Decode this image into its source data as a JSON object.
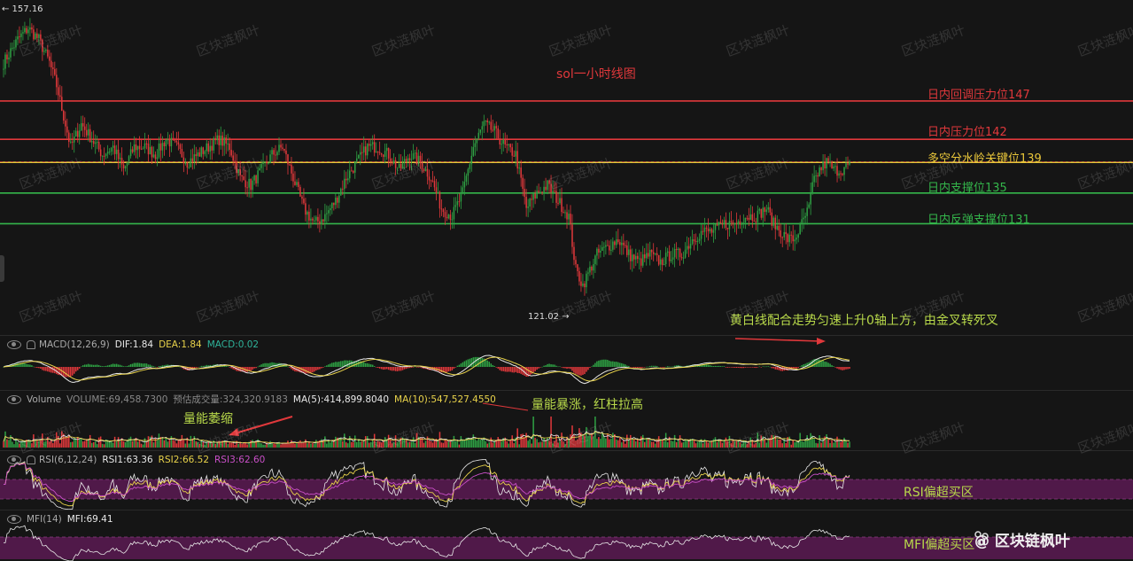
{
  "chart_data": [
    {
      "type": "candlestick",
      "title": "sol一小时线图",
      "ylim": [
        118,
        159
      ],
      "price_high_label": "← 157.16",
      "price_low_label": "121.02 →",
      "levels": [
        {
          "value": 147,
          "label": "日内回调压力位147",
          "color": "#e0383b"
        },
        {
          "value": 142,
          "label": "日内压力位142",
          "color": "#e0383b"
        },
        {
          "value": 139,
          "label": "多空分水岭关键位139",
          "color": "#e8c53a"
        },
        {
          "value": 135,
          "label": "日内支撑位135",
          "color": "#34b64b"
        },
        {
          "value": 131,
          "label": "日内反弹支撑位131",
          "color": "#34b64b"
        }
      ],
      "anchors": [
        [
          0,
          152
        ],
        [
          8,
          155
        ],
        [
          14,
          156.5
        ],
        [
          20,
          155
        ],
        [
          26,
          152
        ],
        [
          30,
          149
        ],
        [
          34,
          145
        ],
        [
          38,
          141
        ],
        [
          44,
          144
        ],
        [
          50,
          142
        ],
        [
          56,
          140
        ],
        [
          62,
          141
        ],
        [
          68,
          138
        ],
        [
          74,
          141
        ],
        [
          80,
          141
        ],
        [
          86,
          140
        ],
        [
          92,
          142
        ],
        [
          98,
          141
        ],
        [
          104,
          139
        ],
        [
          110,
          140
        ],
        [
          116,
          141
        ],
        [
          122,
          142
        ],
        [
          128,
          141
        ],
        [
          134,
          137
        ],
        [
          140,
          136
        ],
        [
          146,
          138
        ],
        [
          152,
          140
        ],
        [
          158,
          141
        ],
        [
          164,
          137
        ],
        [
          170,
          133
        ],
        [
          176,
          131
        ],
        [
          182,
          132
        ],
        [
          188,
          134
        ],
        [
          194,
          137
        ],
        [
          200,
          139
        ],
        [
          206,
          141
        ],
        [
          212,
          141
        ],
        [
          218,
          140
        ],
        [
          224,
          138
        ],
        [
          230,
          140
        ],
        [
          236,
          139
        ],
        [
          242,
          137
        ],
        [
          248,
          133
        ],
        [
          254,
          132
        ],
        [
          260,
          135
        ],
        [
          266,
          141
        ],
        [
          272,
          144
        ],
        [
          278,
          143
        ],
        [
          284,
          141
        ],
        [
          290,
          140
        ],
        [
          296,
          133
        ],
        [
          302,
          135
        ],
        [
          308,
          136
        ],
        [
          314,
          134
        ],
        [
          320,
          132
        ],
        [
          324,
          125
        ],
        [
          328,
          123
        ],
        [
          332,
          125
        ],
        [
          336,
          127
        ],
        [
          342,
          128
        ],
        [
          348,
          129
        ],
        [
          354,
          127
        ],
        [
          360,
          126
        ],
        [
          366,
          127
        ],
        [
          372,
          126
        ],
        [
          378,
          127
        ],
        [
          384,
          127
        ],
        [
          390,
          129
        ],
        [
          396,
          130
        ],
        [
          402,
          130
        ],
        [
          408,
          131
        ],
        [
          414,
          131
        ],
        [
          420,
          132
        ],
        [
          426,
          132
        ],
        [
          432,
          133
        ],
        [
          436,
          131
        ],
        [
          440,
          130
        ],
        [
          444,
          129
        ],
        [
          448,
          129
        ],
        [
          452,
          131
        ],
        [
          456,
          133
        ],
        [
          458,
          136
        ],
        [
          462,
          138
        ],
        [
          466,
          139
        ],
        [
          470,
          138
        ],
        [
          474,
          138
        ],
        [
          478,
          138.5
        ]
      ],
      "n": 480
    },
    {
      "type": "macd",
      "header": {
        "name": "MACD(12,26,9)",
        "dif": "DIF:1.84",
        "dea": "DEA:1.84",
        "macd": "MACD:0.02"
      }
    },
    {
      "type": "volume",
      "header": {
        "name": "Volume",
        "volume": "VOLUME:69,458.7300",
        "est": "预估成交量:324,320.9183",
        "ma5": "MA(5):414,899.8040",
        "ma10": "MA(10):547,527.4550"
      }
    },
    {
      "type": "rsi",
      "header": {
        "name": "RSI(6,12,24)",
        "rsi1": "RSI1:63.36",
        "rsi2": "RSI2:66.52",
        "rsi3": "RSI3:62.60"
      },
      "zone_label": "RSI偏超买区"
    },
    {
      "type": "mfi",
      "header": {
        "name": "MFI(14)",
        "mfi": "MFI:69.41"
      },
      "zone_label": "MFI偏超买区"
    }
  ],
  "annotations": {
    "macd_note": "黄白线配合走势匀速上升0轴上方，由金叉转死叉",
    "vol_shrink": "量能萎缩",
    "vol_surge": "量能暴涨，红柱拉高"
  },
  "watermark": "区块涟枫叶",
  "brand": "@ 区块链枫叶",
  "colors": {
    "up": "#2ea043",
    "down": "#e0383b",
    "bg": "#151515",
    "yellow": "#e8d24a",
    "purple": "#5b1a52"
  }
}
